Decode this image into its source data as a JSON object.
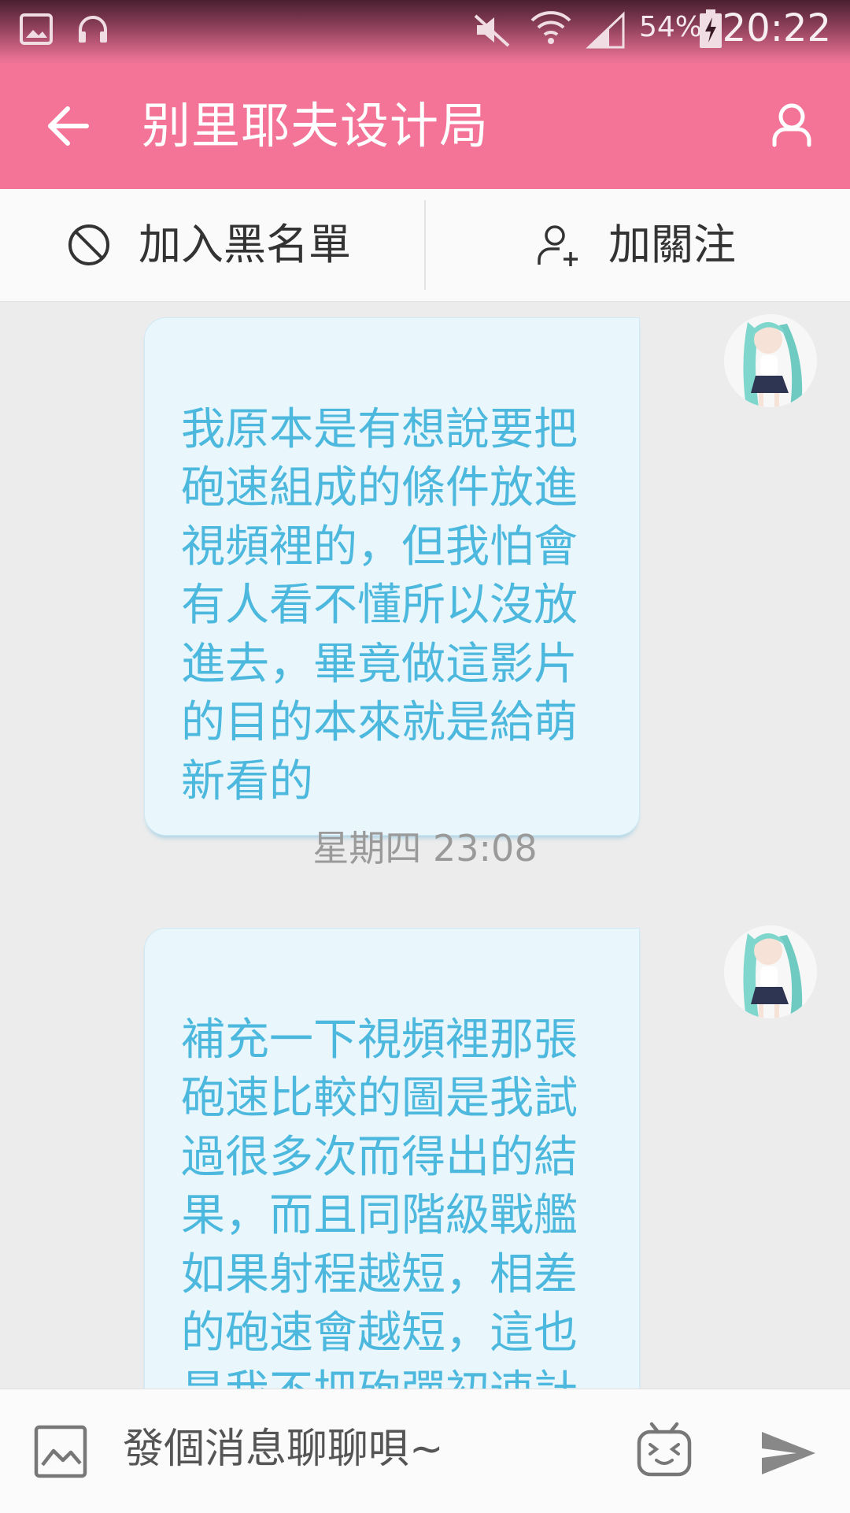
{
  "status_bar": {
    "battery_text": "54%",
    "clock": "20:22",
    "icons": [
      "gallery-icon",
      "headphones-icon",
      "mute-icon",
      "wifi-icon",
      "signal-icon",
      "battery-charging-icon"
    ]
  },
  "app_bar": {
    "title": "别里耶夫设计局",
    "icons": [
      "back-arrow-icon",
      "profile-icon"
    ]
  },
  "actions": {
    "block_label": "加入黑名單",
    "follow_label": "加關注",
    "icons": [
      "block-icon",
      "add-user-icon"
    ]
  },
  "messages": [
    {
      "text": "我原本是有想說要把\n砲速組成的條件放進\n視頻裡的，但我怕會\n有人看不懂所以沒放\n進去，畢竟做這影片\n的目的本來就是給萌\n新看的"
    },
    {
      "text": "補充一下視頻裡那張\n砲速比較的圖是我試\n過很多次而得出的結\n果，而且同階級戰艦\n如果射程越短，相差\n的砲速會越短，這也\n是我不把砲彈初速計\n算進去的原因之"
    }
  ],
  "timestamp": "星期四 23:08",
  "composer": {
    "placeholder": "發個消息聊聊唄~",
    "icons": [
      "image-icon",
      "emoji-icon",
      "send-icon"
    ]
  },
  "colors": {
    "accent": "#f37497",
    "bubble_bg": "#e9f7fd",
    "bubble_text": "#4db8dd",
    "chat_bg": "#ececec"
  }
}
